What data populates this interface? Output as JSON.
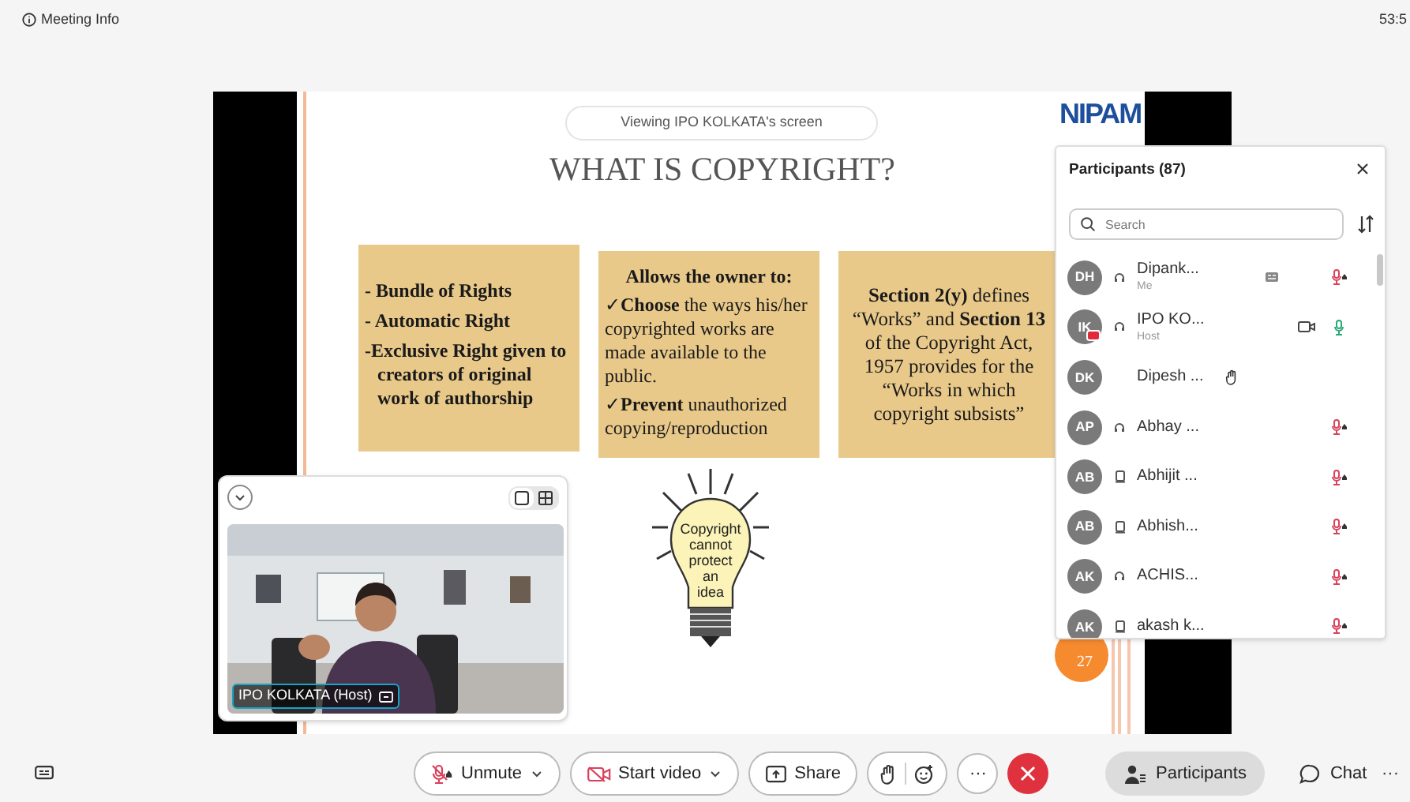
{
  "top_bar": {
    "meeting_info": "Meeting Info",
    "timer": "53:5"
  },
  "shared_screen": {
    "banner": "Viewing IPO KOLKATA's screen",
    "logo": "NIPAM",
    "slide_title": "WHAT IS COPYRIGHT?",
    "boxes": [
      {
        "kind": "list",
        "lines": [
          "- Bundle of Rights",
          "- Automatic Right",
          "-Exclusive Right given to creators of original work of authorship"
        ]
      },
      {
        "kind": "checklist",
        "heading": "Allows the owner to:",
        "lines": [
          "✓**Choose** the ways his/her copyrighted works are made available to the public.",
          "✓**Prevent** unauthorized copying/reproduction"
        ]
      },
      {
        "kind": "paragraph",
        "text": "**Section 2(y)** defines “Works” and **Section 13** of the Copyright Act, 1957 provides for the “Works in which copyright subsists”"
      }
    ],
    "bulb_lines": [
      "Copyright",
      "cannot",
      "protect",
      "an",
      "idea"
    ],
    "page_badge": "27"
  },
  "self_view": {
    "layouts": [
      {
        "kind": "single",
        "selected": true
      },
      {
        "kind": "grid",
        "selected": false
      }
    ],
    "name_label": "IPO KOLKATA (Host)"
  },
  "participants": {
    "title": "Participants (87)",
    "search": {
      "placeholder": "Search"
    },
    "items": [
      {
        "initials": "DH",
        "name": "Dipank...",
        "role": "Me",
        "kind": "headset",
        "sharing": false,
        "hand_raised": false,
        "captions": true,
        "video": false,
        "audio": true,
        "muted": true
      },
      {
        "initials": "IK",
        "name": "IPO KO...",
        "role": "Host",
        "kind": "headset",
        "sharing": true,
        "hand_raised": false,
        "captions": false,
        "video": true,
        "audio": true,
        "muted": false
      },
      {
        "initials": "DK",
        "name": "Dipesh ...",
        "kind": "none",
        "sharing": false,
        "hand_raised": true,
        "captions": false,
        "video": false,
        "audio": false
      },
      {
        "initials": "AP",
        "name": "Abhay ...",
        "kind": "headset",
        "sharing": false,
        "hand_raised": false,
        "captions": false,
        "video": false,
        "audio": true,
        "muted": true
      },
      {
        "initials": "AB",
        "name": "Abhijit ...",
        "kind": "laptop",
        "sharing": false,
        "hand_raised": false,
        "captions": false,
        "video": false,
        "audio": true,
        "muted": true
      },
      {
        "initials": "AB",
        "name": "Abhish...",
        "kind": "laptop",
        "sharing": false,
        "hand_raised": false,
        "captions": false,
        "video": false,
        "audio": true,
        "muted": true
      },
      {
        "initials": "AK",
        "name": "ACHIS...",
        "kind": "headset",
        "sharing": false,
        "hand_raised": false,
        "captions": false,
        "video": false,
        "audio": true,
        "muted": true
      },
      {
        "initials": "AK",
        "name": "akash k...",
        "kind": "laptop",
        "sharing": false,
        "hand_raised": false,
        "captions": false,
        "video": false,
        "audio": true,
        "muted": true
      }
    ]
  },
  "toolbar": {
    "controls": [
      {
        "kind": "mic",
        "label": "Unmute",
        "has_menu": true
      },
      {
        "kind": "video",
        "label": "Start video",
        "has_menu": true
      },
      {
        "kind": "share",
        "label": "Share",
        "has_menu": false
      }
    ],
    "more": "···",
    "panels": [
      {
        "kind": "participants",
        "label": "Participants",
        "selected": true
      },
      {
        "kind": "chat",
        "label": "Chat",
        "selected": false
      }
    ],
    "overflow": "···"
  }
}
